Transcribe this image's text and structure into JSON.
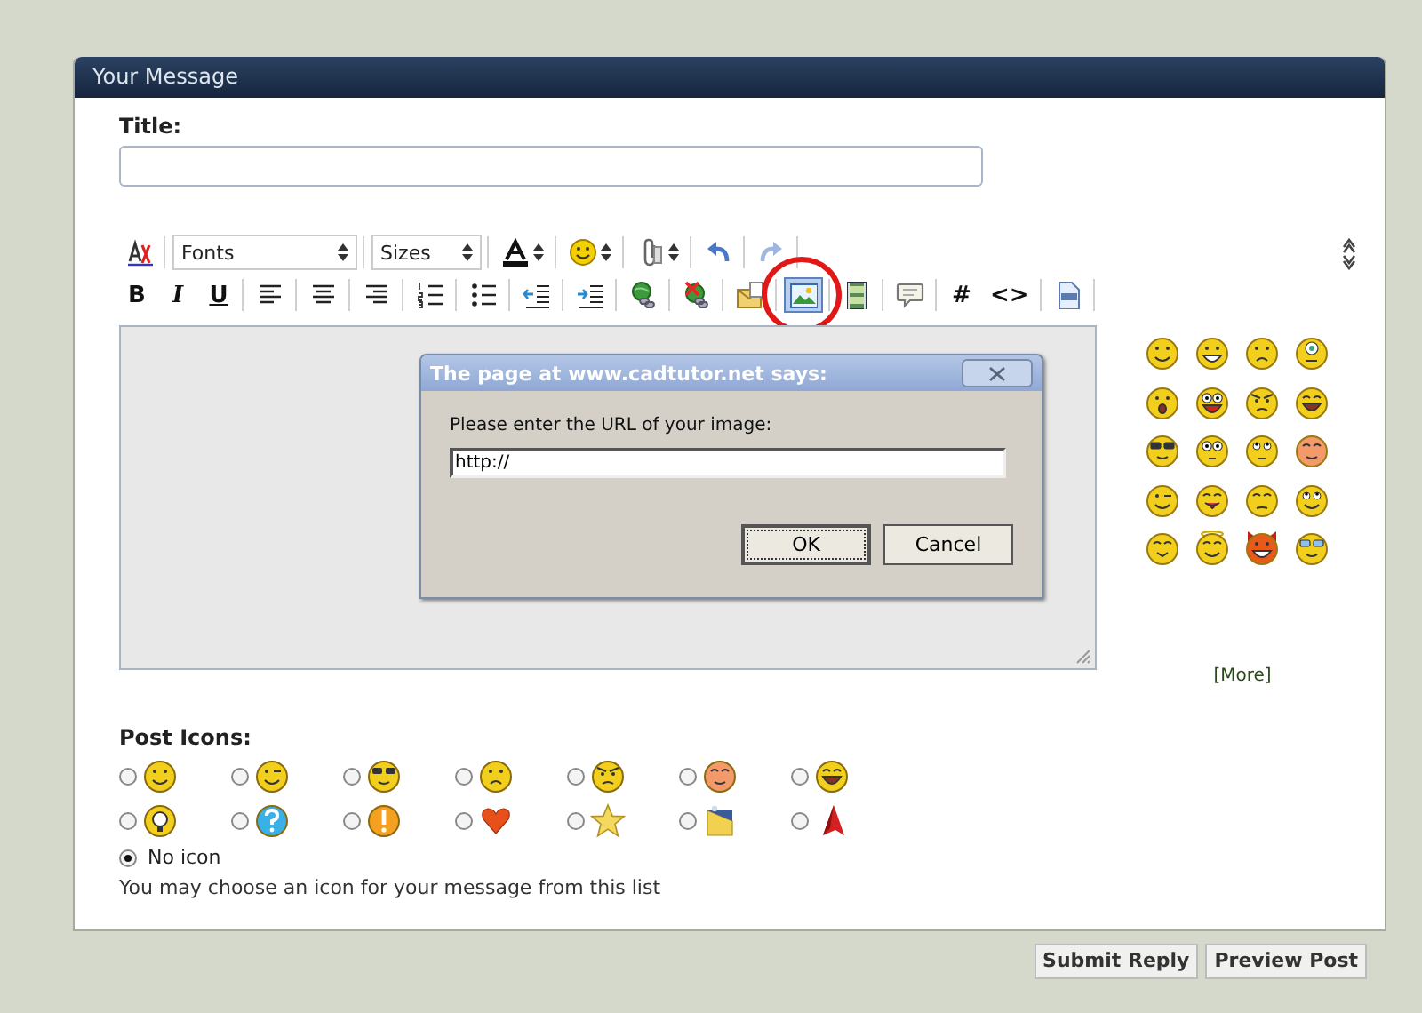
{
  "panel": {
    "title": "Your Message"
  },
  "title_field": {
    "label": "Title:"
  },
  "toolbar_rows": [
    [
      {
        "kind": "removeformat",
        "pressed": false
      },
      {
        "kind": "fonts",
        "label": "Fonts",
        "pressed": false
      },
      {
        "kind": "sizes",
        "label": "Sizes",
        "pressed": false
      },
      {
        "kind": "textcolor",
        "pressed": false
      },
      {
        "kind": "smiley",
        "pressed": false
      },
      {
        "kind": "paperclip",
        "pressed": false
      },
      {
        "kind": "undo",
        "pressed": false
      },
      {
        "kind": "redo",
        "pressed": false
      }
    ],
    [
      {
        "kind": "bold",
        "label": "B",
        "pressed": false
      },
      {
        "kind": "italic",
        "label": "I",
        "pressed": false
      },
      {
        "kind": "underline",
        "label": "U",
        "pressed": false
      },
      {
        "kind": "alignleft",
        "pressed": false
      },
      {
        "kind": "aligncenter",
        "pressed": false
      },
      {
        "kind": "alignright",
        "pressed": false
      },
      {
        "kind": "numberedlist",
        "pressed": false
      },
      {
        "kind": "bulletlist",
        "pressed": false
      },
      {
        "kind": "outdent",
        "pressed": false
      },
      {
        "kind": "indent",
        "pressed": false
      },
      {
        "kind": "link",
        "pressed": false
      },
      {
        "kind": "unlink",
        "pressed": false
      },
      {
        "kind": "email",
        "pressed": false
      },
      {
        "kind": "image",
        "pressed": true
      },
      {
        "kind": "video",
        "pressed": false
      },
      {
        "kind": "quote",
        "pressed": false
      },
      {
        "kind": "hash",
        "label": "#",
        "pressed": false
      },
      {
        "kind": "code",
        "label": "<>",
        "pressed": false
      },
      {
        "kind": "php",
        "pressed": false
      }
    ]
  ],
  "dialog": {
    "title": "The page at www.cadtutor.net says:",
    "message": "Please enter the URL of your image:",
    "value": "http://",
    "buttons": [
      {
        "label": "OK",
        "default": true
      },
      {
        "label": "Cancel",
        "default": false
      }
    ]
  },
  "smilies": [
    {
      "kind": "smile"
    },
    {
      "kind": "grin"
    },
    {
      "kind": "frown"
    },
    {
      "kind": "sick"
    },
    {
      "kind": "surprised"
    },
    {
      "kind": "crazy"
    },
    {
      "kind": "angry"
    },
    {
      "kind": "laugh"
    },
    {
      "kind": "cool"
    },
    {
      "kind": "eek"
    },
    {
      "kind": "rolleyes"
    },
    {
      "kind": "blush"
    },
    {
      "kind": "wink"
    },
    {
      "kind": "tongue"
    },
    {
      "kind": "sleepy"
    },
    {
      "kind": "happy"
    },
    {
      "kind": "confused"
    },
    {
      "kind": "angel"
    },
    {
      "kind": "devil"
    },
    {
      "kind": "nerd"
    }
  ],
  "more_link": "[More]",
  "post_icons": {
    "label": "Post Icons:",
    "items": [
      {
        "kind": "smile",
        "selected": false
      },
      {
        "kind": "wink",
        "selected": false
      },
      {
        "kind": "cool",
        "selected": false
      },
      {
        "kind": "frown",
        "selected": false
      },
      {
        "kind": "angry",
        "selected": false
      },
      {
        "kind": "blush",
        "selected": false
      },
      {
        "kind": "laugh",
        "selected": false
      },
      {
        "kind": "bulb",
        "selected": false
      },
      {
        "kind": "question",
        "selected": false
      },
      {
        "kind": "warning",
        "selected": false
      },
      {
        "kind": "heart",
        "selected": false
      },
      {
        "kind": "star",
        "selected": false
      },
      {
        "kind": "picture",
        "selected": false
      },
      {
        "kind": "logo",
        "selected": false
      }
    ],
    "no_icon": {
      "label": "No icon",
      "selected": true
    },
    "hint": "You may choose an icon for your message from this list"
  },
  "buttons": [
    "Submit Reply",
    "Preview Post"
  ]
}
